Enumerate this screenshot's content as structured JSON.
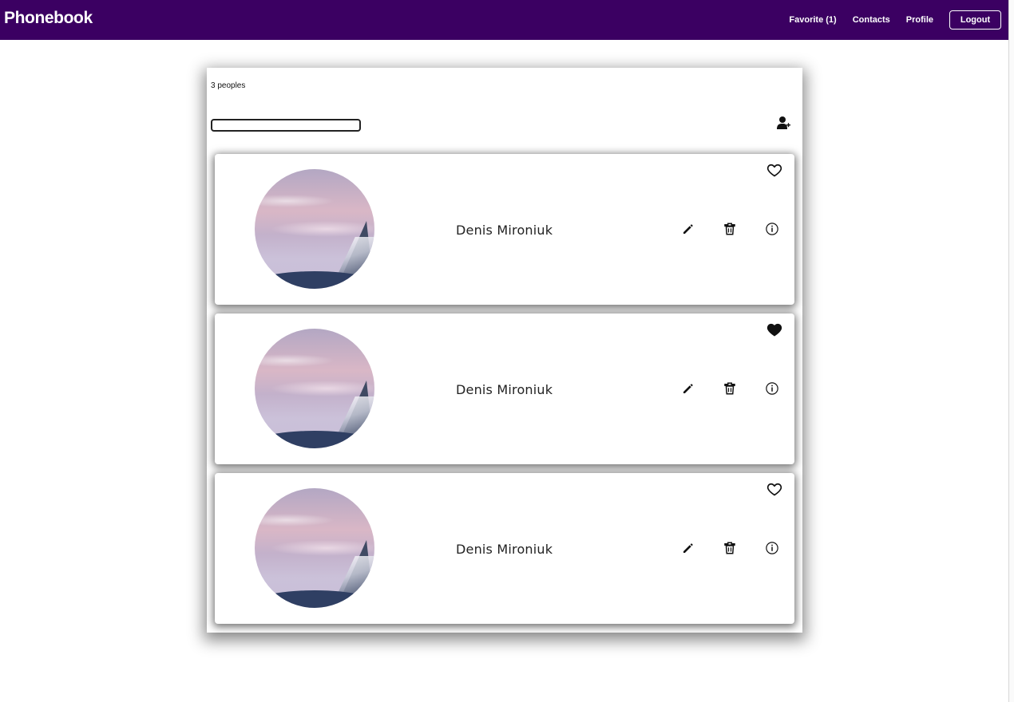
{
  "navbar": {
    "brand": "Phonebook",
    "links": [
      "Favorite (1)",
      "Contacts",
      "Profile"
    ],
    "logout_label": "Logout",
    "background_color": "#3b0062"
  },
  "contacts_panel": {
    "count_text": "3 peoples",
    "search": {
      "value": "",
      "placeholder": ""
    },
    "add_contact_icon": "add-user-icon"
  },
  "contacts": [
    {
      "name": "Denis Mironiuk",
      "favorite": false
    },
    {
      "name": "Denis Mironiuk",
      "favorite": true
    },
    {
      "name": "Denis Mironiuk",
      "favorite": false
    }
  ],
  "icons": {
    "favorite": "heart-icon",
    "edit": "pencil-icon",
    "delete": "trash-icon",
    "info": "info-icon"
  }
}
